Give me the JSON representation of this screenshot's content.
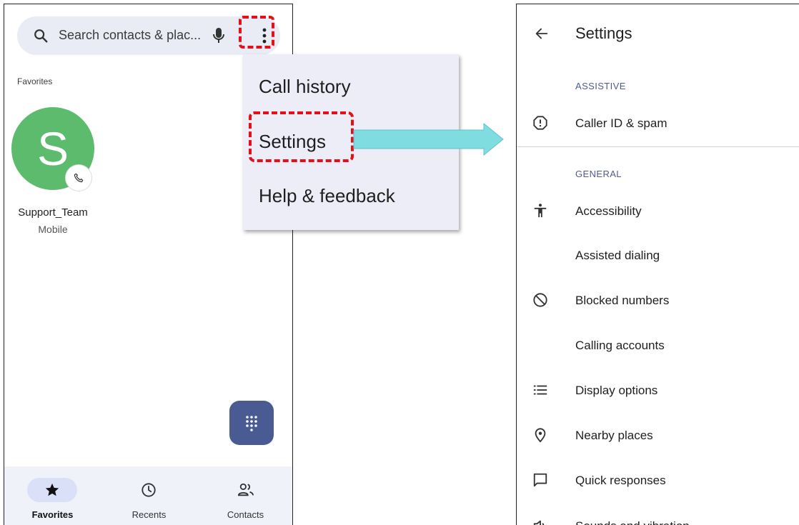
{
  "dialer": {
    "search_placeholder": "Search contacts & plac...",
    "favorites_heading": "Favorites",
    "contact": {
      "initial": "S",
      "name": "Support_Team",
      "type": "Mobile",
      "avatar_color": "#5dbb6e"
    },
    "nav": [
      {
        "label": "Favorites",
        "icon": "star-icon",
        "active": true
      },
      {
        "label": "Recents",
        "icon": "clock-icon",
        "active": false
      },
      {
        "label": "Contacts",
        "icon": "people-icon",
        "active": false
      }
    ],
    "fab_icon": "dialpad-icon",
    "accent_color": "#4a5a93"
  },
  "menu": {
    "items": [
      "Call history",
      "Settings",
      "Help & feedback"
    ],
    "highlighted": "Settings"
  },
  "annotation": {
    "highlight_color": "#e3101a",
    "arrow_color": "#7fdde0"
  },
  "settings": {
    "title": "Settings",
    "sections": [
      {
        "label": "ASSISTIVE",
        "items": [
          {
            "label": "Caller ID & spam",
            "icon": "alert-circle-icon"
          }
        ]
      },
      {
        "label": "GENERAL",
        "items": [
          {
            "label": "Accessibility",
            "icon": "accessibility-icon"
          },
          {
            "label": "Assisted dialing",
            "icon": ""
          },
          {
            "label": "Blocked numbers",
            "icon": "block-icon"
          },
          {
            "label": "Calling accounts",
            "icon": ""
          },
          {
            "label": "Display options",
            "icon": "list-icon"
          },
          {
            "label": "Nearby places",
            "icon": "location-pin-icon"
          },
          {
            "label": "Quick responses",
            "icon": "message-icon"
          },
          {
            "label": "Sounds and vibration",
            "icon": "volume-icon"
          }
        ]
      }
    ]
  }
}
